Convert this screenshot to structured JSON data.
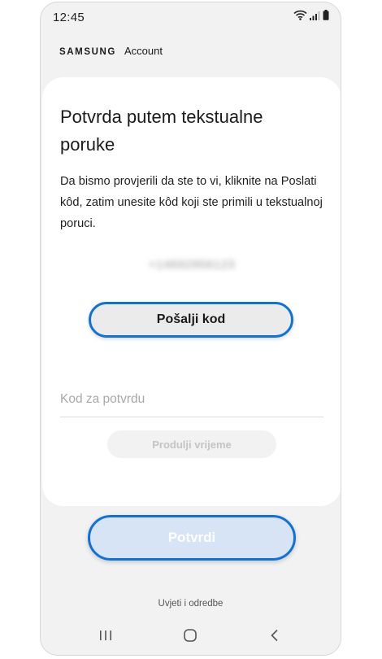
{
  "status_bar": {
    "time": "12:45",
    "icons": [
      "wifi-icon",
      "signal-icon",
      "battery-icon"
    ]
  },
  "brand": {
    "logo": "SAMSUNG",
    "product": "Account"
  },
  "card": {
    "title": "Potvrda putem tekstualne poruke",
    "description": "Da bismo provjerili da ste to vi, kliknite na Poslati kôd, zatim unesite kôd koji ste primili u tekstualnoj poruci.",
    "phone_number": "+14692956123",
    "send_code_label": "Pošalji kod",
    "code_field": {
      "placeholder": "Kod za potvrdu",
      "value": ""
    },
    "extend_time_label": "Produlji vrijeme"
  },
  "confirm_label": "Potvrdi",
  "terms_link": "Uvjeti i odredbe",
  "nav_bar": {
    "icons": [
      "recent-apps-icon",
      "home-icon",
      "back-icon"
    ]
  },
  "colors": {
    "accent": "#0f72d8",
    "confirm_disabled_bg": "#d7e4f5",
    "background": "#f2f2f2"
  }
}
